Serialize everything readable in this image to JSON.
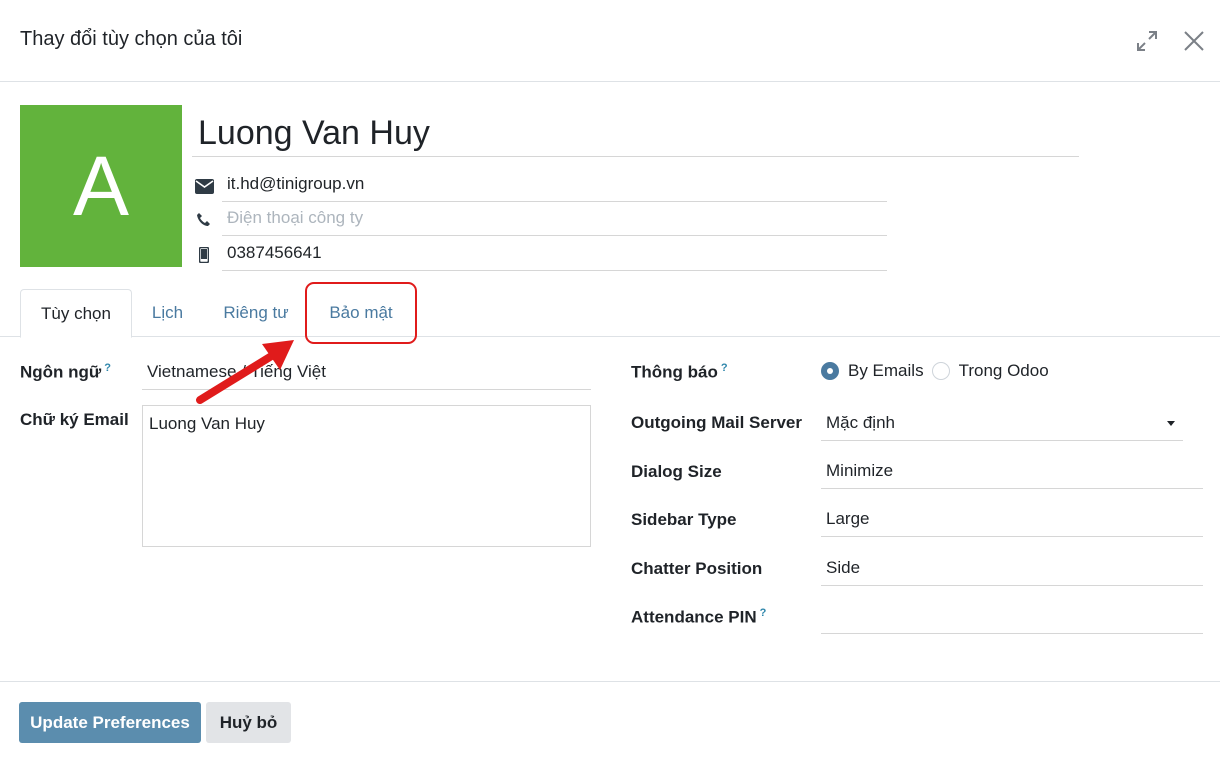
{
  "dialog": {
    "title": "Thay đổi tùy chọn của tôi"
  },
  "profile": {
    "avatar_letter": "A",
    "avatar_color": "#62b33c",
    "name": "Luong Van Huy",
    "email": "it.hd@tinigroup.vn",
    "work_phone_placeholder": "Điện thoại công ty",
    "mobile": "0387456641"
  },
  "tabs": [
    {
      "label": "Tùy chọn",
      "active": true
    },
    {
      "label": "Lịch",
      "active": false
    },
    {
      "label": "Riêng tư",
      "active": false
    },
    {
      "label": "Bảo mật",
      "active": false
    }
  ],
  "left_form": {
    "language_label": "Ngôn ngữ",
    "language_value": "Vietnamese / Tiếng Việt",
    "signature_label": "Chữ ký Email",
    "signature_value": "Luong Van Huy"
  },
  "right_form": {
    "notification_label": "Thông báo",
    "notification_options": [
      "By Emails",
      "Trong Odoo"
    ],
    "notification_selected": "By Emails",
    "mail_server_label": "Outgoing Mail Server",
    "mail_server_value": "Mặc định",
    "dialog_size_label": "Dialog Size",
    "dialog_size_value": "Minimize",
    "sidebar_type_label": "Sidebar Type",
    "sidebar_type_value": "Large",
    "chatter_position_label": "Chatter Position",
    "chatter_position_value": "Side",
    "attendance_pin_label": "Attendance PIN",
    "attendance_pin_value": ""
  },
  "footer": {
    "update_label": "Update Preferences",
    "cancel_label": "Huỷ bỏ"
  },
  "colors": {
    "primary": "#5b8dae",
    "link": "#4a7aa0",
    "annotation": "#e01b1b"
  }
}
